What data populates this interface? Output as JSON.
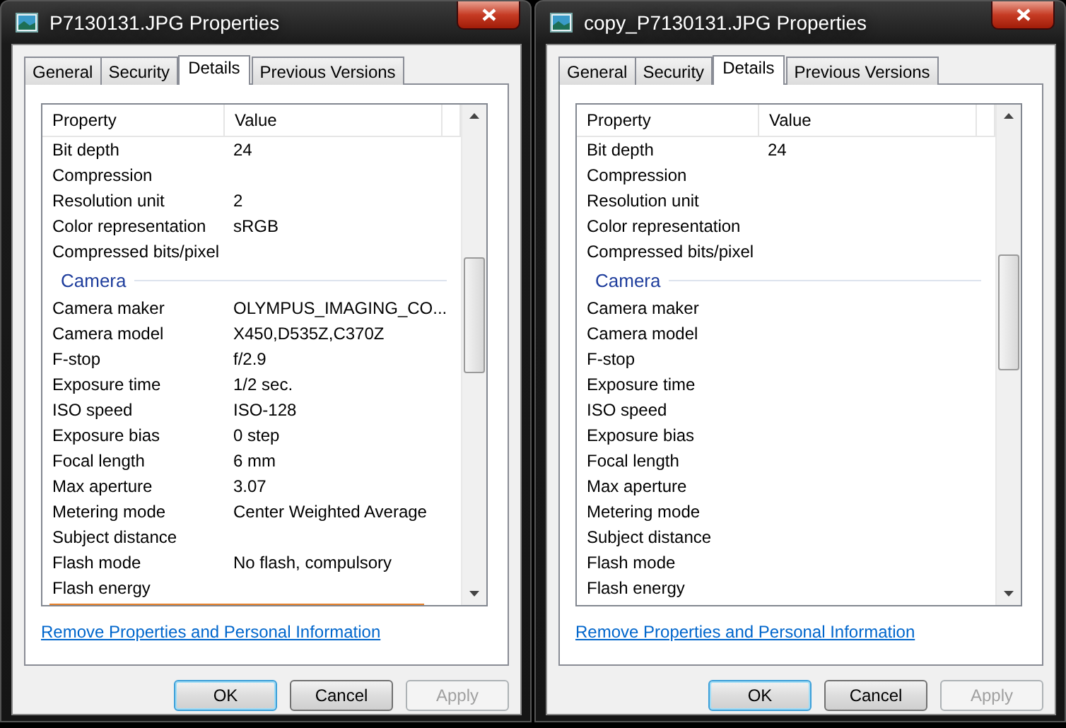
{
  "windows": [
    {
      "title": "P7130131.JPG Properties",
      "tabs": [
        {
          "label": "General",
          "selected": false
        },
        {
          "label": "Security",
          "selected": false
        },
        {
          "label": "Details",
          "selected": true
        },
        {
          "label": "Previous Versions",
          "selected": false
        }
      ],
      "columns": [
        "Property",
        "Value"
      ],
      "rows": [
        {
          "kind": "row",
          "property": "Bit depth",
          "value": "24"
        },
        {
          "kind": "row",
          "property": "Compression"
        },
        {
          "kind": "row",
          "property": "Resolution unit",
          "value": "2"
        },
        {
          "kind": "row",
          "property": "Color representation",
          "value": "sRGB"
        },
        {
          "kind": "row",
          "property": "Compressed bits/pixel"
        },
        {
          "kind": "group",
          "label": "Camera"
        },
        {
          "kind": "row",
          "property": "Camera maker",
          "value": "OLYMPUS_IMAGING_CO..."
        },
        {
          "kind": "row",
          "property": "Camera model",
          "value": "X450,D535Z,C370Z"
        },
        {
          "kind": "row",
          "property": "F-stop",
          "value": "f/2.9"
        },
        {
          "kind": "row",
          "property": "Exposure time",
          "value": "1/2 sec."
        },
        {
          "kind": "row",
          "property": "ISO speed",
          "value": "ISO-128"
        },
        {
          "kind": "row",
          "property": "Exposure bias",
          "value": "0 step"
        },
        {
          "kind": "row",
          "property": "Focal length",
          "value": "6 mm"
        },
        {
          "kind": "row",
          "property": "Max aperture",
          "value": "3.07"
        },
        {
          "kind": "row",
          "property": "Metering mode",
          "value": "Center Weighted Average"
        },
        {
          "kind": "row",
          "property": "Subject distance"
        },
        {
          "kind": "row",
          "property": "Flash mode",
          "value": "No flash, compulsory"
        },
        {
          "kind": "row",
          "property": "Flash energy"
        }
      ],
      "link": "Remove Properties and Personal Information",
      "buttons": [
        {
          "label": "OK",
          "default": true,
          "disabled": false
        },
        {
          "label": "Cancel",
          "default": false,
          "disabled": false
        },
        {
          "label": "Apply",
          "default": false,
          "disabled": true
        }
      ]
    },
    {
      "title": "copy_P7130131.JPG Properties",
      "tabs": [
        {
          "label": "General",
          "selected": false
        },
        {
          "label": "Security",
          "selected": false
        },
        {
          "label": "Details",
          "selected": true
        },
        {
          "label": "Previous Versions",
          "selected": false
        }
      ],
      "columns": [
        "Property",
        "Value"
      ],
      "rows": [
        {
          "kind": "row",
          "property": "Bit depth",
          "value": "24"
        },
        {
          "kind": "row",
          "property": "Compression"
        },
        {
          "kind": "row",
          "property": "Resolution unit"
        },
        {
          "kind": "row",
          "property": "Color representation"
        },
        {
          "kind": "row",
          "property": "Compressed bits/pixel"
        },
        {
          "kind": "group",
          "label": "Camera"
        },
        {
          "kind": "row",
          "property": "Camera maker"
        },
        {
          "kind": "row",
          "property": "Camera model"
        },
        {
          "kind": "row",
          "property": "F-stop"
        },
        {
          "kind": "row",
          "property": "Exposure time"
        },
        {
          "kind": "row",
          "property": "ISO speed"
        },
        {
          "kind": "row",
          "property": "Exposure bias"
        },
        {
          "kind": "row",
          "property": "Focal length"
        },
        {
          "kind": "row",
          "property": "Max aperture"
        },
        {
          "kind": "row",
          "property": "Metering mode"
        },
        {
          "kind": "row",
          "property": "Subject distance"
        },
        {
          "kind": "row",
          "property": "Flash mode"
        },
        {
          "kind": "row",
          "property": "Flash energy"
        }
      ],
      "link": "Remove Properties and Personal Information",
      "buttons": [
        {
          "label": "OK",
          "default": true,
          "disabled": false
        },
        {
          "label": "Cancel",
          "default": false,
          "disabled": false
        },
        {
          "label": "Apply",
          "default": false,
          "disabled": true
        }
      ]
    }
  ]
}
